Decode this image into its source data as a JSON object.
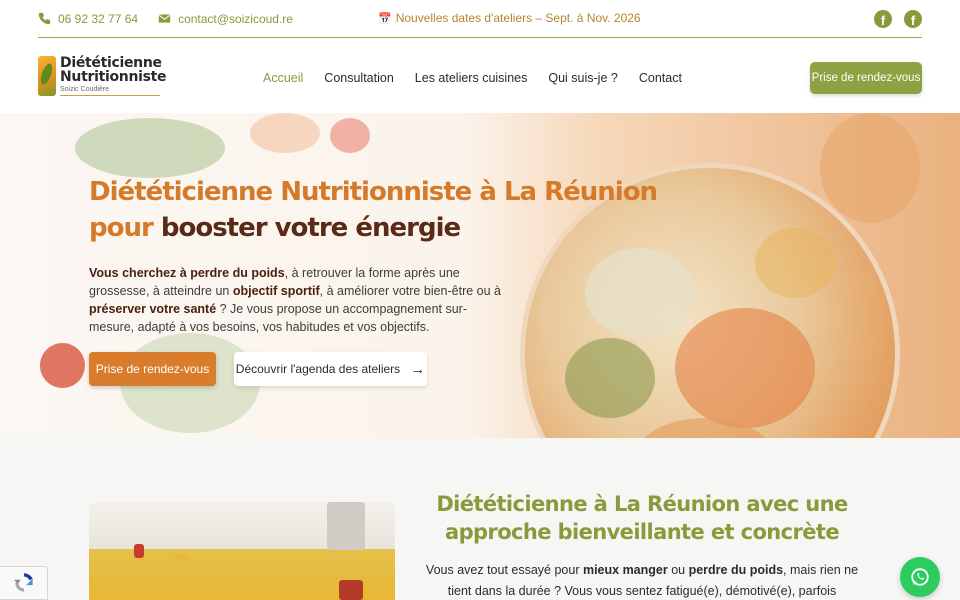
{
  "topbar": {
    "phone": "06 92 32 77 64",
    "email": "contact@soizicoud.re",
    "announcement": "Nouvelles dates d'ateliers – Sept. à Nov. 2026",
    "social": [
      "facebook-icon",
      "facebook-icon"
    ]
  },
  "header": {
    "logo_line1": "Diététicienne",
    "logo_line2": "Nutritionniste",
    "logo_line3": "Soizic Coudière",
    "nav": [
      "Accueil",
      "Consultation",
      "Les ateliers cuisines",
      "Qui suis-je ?",
      "Contact"
    ],
    "active_nav": "Accueil",
    "cta": "Prise de rendez-vous"
  },
  "hero": {
    "title_line1": "Diététicienne Nutritionniste à La Réunion",
    "title_pre": "pour ",
    "title_emph": "booster votre énergie",
    "p_b1": "Vous cherchez à perdre du poids",
    "p_t1": ", à retrouver la forme après une grossesse, à atteindre un ",
    "p_b2": "objectif sportif",
    "p_t2": ", à améliorer votre bien-être ou à ",
    "p_b3": "préserver votre santé",
    "p_t3": " ? Je vous propose un accompagnement sur-mesure, adapté à vos besoins, vos habitudes et vos objectifs.",
    "btn_primary": "Prise de rendez-vous",
    "btn_secondary": "Découvrir l'agenda des ateliers"
  },
  "section2": {
    "title": "Diététicienne à La Réunion avec une approche bienveillante et concrète",
    "t1": "Vous avez tout essayé pour ",
    "b1": "mieux manger",
    "t2": " ou ",
    "b2": "perdre du poids",
    "t3": ", mais rien ne tient dans la durée ? Vous vous sentez fatigué(e), démotivé(e), parfois"
  },
  "colors": {
    "accent_green": "#8da243",
    "accent_orange": "#d97d2d",
    "title_brown": "#5a2a18",
    "whatsapp": "#2ccd5e"
  }
}
